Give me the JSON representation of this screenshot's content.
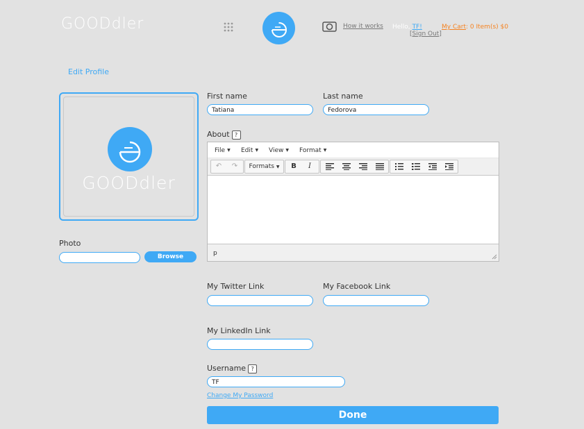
{
  "header": {
    "logo_text": "GOODdler",
    "how_it_works": "How it works",
    "hello_prefix": "Hello,",
    "username_short": "TF!",
    "sign_out": "Sign Out",
    "cart_label": "My Cart",
    "cart_summary": ": 0 Item(s) $0"
  },
  "page": {
    "title": "Edit Profile"
  },
  "avatar": {
    "logo_text": "GOODdler"
  },
  "photo": {
    "label": "Photo",
    "value": "",
    "browse_label": "Browse"
  },
  "form": {
    "first_name": {
      "label": "First name",
      "value": "Tatiana"
    },
    "last_name": {
      "label": "Last name",
      "value": "Fedorova"
    },
    "about": {
      "label": "About",
      "help": "?"
    },
    "twitter": {
      "label": "My Twitter Link",
      "value": ""
    },
    "facebook": {
      "label": "My Facebook Link",
      "value": ""
    },
    "linkedin": {
      "label": "My LinkedIn Link",
      "value": ""
    },
    "username": {
      "label": "Username",
      "help": "?",
      "value": "TF"
    },
    "change_password": "Change My Password",
    "done_label": "Done"
  },
  "editor": {
    "menus": [
      "File",
      "Edit",
      "View",
      "Format"
    ],
    "formats_label": "Formats",
    "bold": "B",
    "italic": "I",
    "status_path": "p"
  },
  "colors": {
    "accent": "#3fa9f5",
    "cart": "#f58220",
    "background": "#e2e2e2"
  }
}
